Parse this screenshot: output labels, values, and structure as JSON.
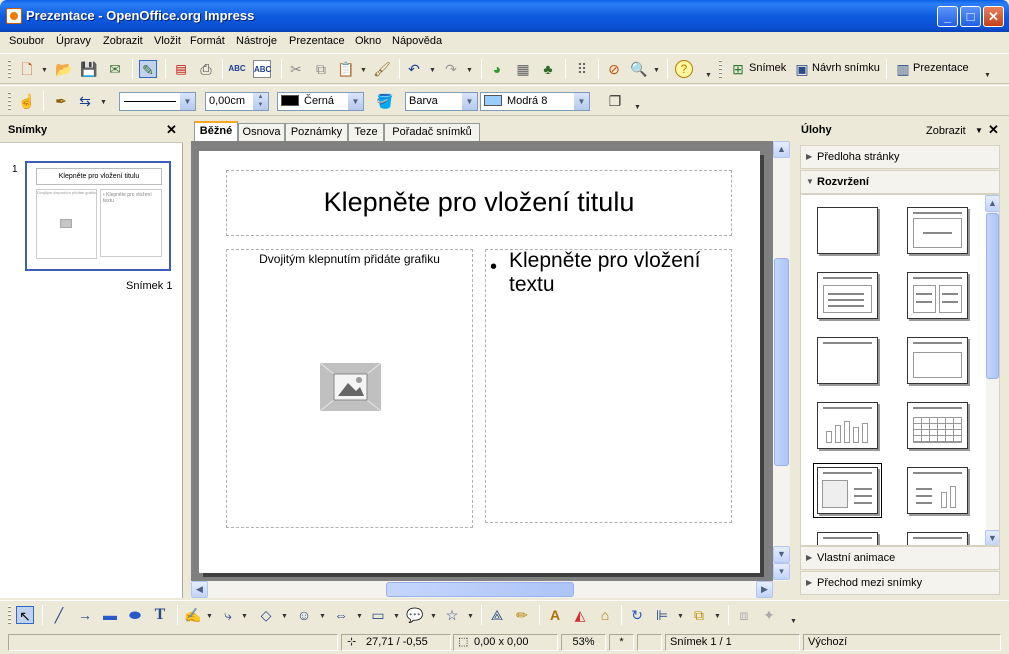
{
  "window": {
    "title": "Prezentace - OpenOffice.org Impress"
  },
  "menu": [
    "Soubor",
    "Úpravy",
    "Zobrazit",
    "Vložit",
    "Formát",
    "Nástroje",
    "Prezentace",
    "Okno",
    "Nápověda"
  ],
  "toolbar": {
    "slide_label": "Snímek",
    "slide_design_label": "Návrh snímku",
    "presentation_label": "Prezentace"
  },
  "line_toolbar": {
    "line_width": "0,00cm",
    "line_color": "Černá",
    "area_style": "Barva",
    "area_color": "Modrá 8",
    "line_color_hex": "#000000",
    "area_color_hex": "#99ccff"
  },
  "slides_panel": {
    "title": "Snímky",
    "slides": [
      {
        "number": "1",
        "caption": "Snímek 1",
        "title": "Klepněte pro vložení titulu",
        "graphic": "Dvojitým klepnutím přidáte grafiku",
        "text": "Klepněte pro vložení textu"
      }
    ]
  },
  "view_tabs": [
    "Běžné",
    "Osnova",
    "Poznámky",
    "Teze",
    "Pořadač snímků"
  ],
  "slide": {
    "title_placeholder": "Klepněte pro vložení titulu",
    "graphic_placeholder": "Dvojitým klepnutím přidáte grafiku",
    "text_bullet": "•",
    "text_placeholder": "Klepněte pro vložení textu"
  },
  "tasks_panel": {
    "title": "Úlohy",
    "view_label": "Zobrazit",
    "sections": {
      "master_pages": "Předloha stránky",
      "layouts": "Rozvržení",
      "custom_animation": "Vlastní animace",
      "slide_transition": "Přechod mezi snímky"
    }
  },
  "statusbar": {
    "position": "27,71 / -0,55",
    "size": "0,00 x 0,00",
    "zoom": "53%",
    "modified": "*",
    "slide": "Snímek 1 / 1",
    "layout": "Výchozí"
  },
  "colors": {
    "titlebar": "#0a5fe6",
    "selection_border": "#3b5fb8",
    "active_tab": "#f7a628"
  }
}
